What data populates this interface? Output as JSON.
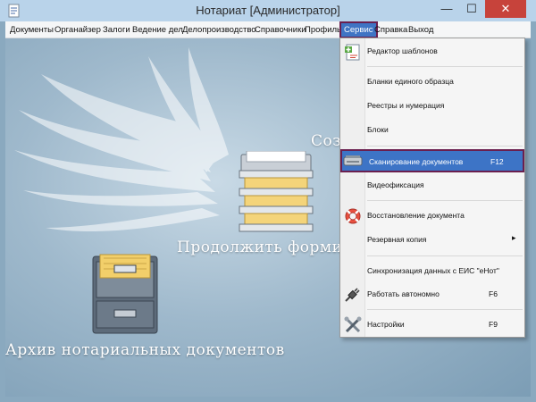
{
  "window": {
    "title": "Нотариат [Администратор]",
    "min_symbol": "—",
    "max_symbol": "☐",
    "close_symbol": "✕"
  },
  "menubar": {
    "items": [
      {
        "label": "Документы"
      },
      {
        "label": "Органайзер"
      },
      {
        "label": "Залоги"
      },
      {
        "label": "Ведение дел"
      },
      {
        "label": "Делопроизводство"
      },
      {
        "label": "Справочники"
      },
      {
        "label": "Профиль"
      },
      {
        "label": "Сервис",
        "active": true
      },
      {
        "label": "Справка"
      },
      {
        "label": "Выход"
      }
    ]
  },
  "workspace": {
    "create_label": "Соз",
    "continue_label": "Продолжить формиров",
    "archive_label": "Архив нотариальных документов"
  },
  "service_menu": {
    "items": [
      {
        "label": "Редактор шаблонов",
        "icon": "template-editor-icon",
        "shortcut": ""
      },
      {
        "label": "Бланки единого образца",
        "icon": "",
        "shortcut": ""
      },
      {
        "label": "Реестры и нумерация",
        "icon": "",
        "shortcut": ""
      },
      {
        "label": "Блоки",
        "icon": "",
        "shortcut": ""
      },
      {
        "label": "Сканирование документов",
        "icon": "scanner-icon",
        "shortcut": "F12",
        "selected": true
      },
      {
        "label": "Видеофиксация",
        "icon": "",
        "shortcut": ""
      },
      {
        "label": "Восстановление документа",
        "icon": "lifebuoy-icon",
        "shortcut": ""
      },
      {
        "label": "Резервная копия",
        "icon": "",
        "shortcut": "",
        "submenu_arrow": "▸"
      },
      {
        "label": "Синхронизация данных с  ЕИС \"еНот\"",
        "icon": "",
        "shortcut": ""
      },
      {
        "label": "Работать автономно",
        "icon": "plug-icon",
        "shortcut": "F6"
      },
      {
        "label": "Настройки",
        "icon": "tools-icon",
        "shortcut": "F9"
      }
    ]
  },
  "colors": {
    "selection": "#3d74c6",
    "selection_border": "#6a1f4f",
    "titlebar": "#b9d3ea",
    "close_button": "#c7433b"
  }
}
